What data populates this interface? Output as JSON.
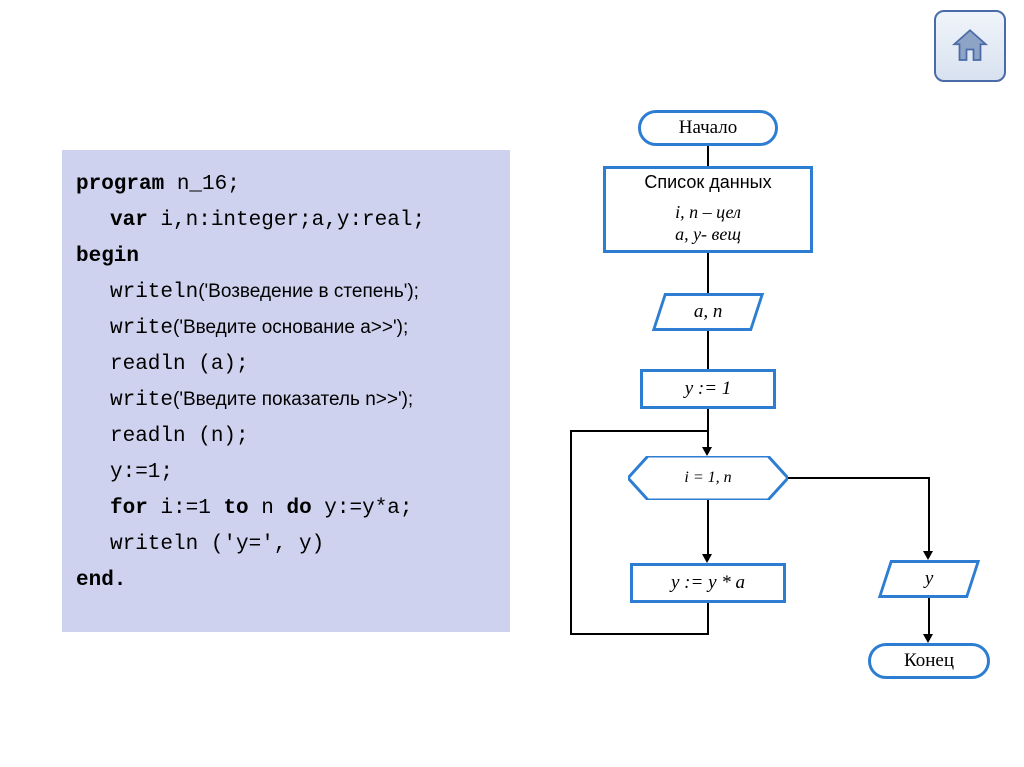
{
  "home": {
    "label": "home"
  },
  "code": {
    "line1_kw": "program",
    "line1_rest": " n_16;",
    "line2_kw": "var",
    "line2_rest": " i,n:integer;a,y:real;",
    "line3": "begin",
    "line4_fn": "writeln",
    "line4_txt": "('Возведение в степень');",
    "line5_fn": "write",
    "line5_txt": "('Введите основание a>>');",
    "line6": "readln (a);",
    "line7_fn": "write",
    "line7_txt": "('Введите показатель n>>');",
    "line8": "readln (n);",
    "line9": "y:=1;",
    "line10_for": "for",
    "line10_mid": " i:=1 ",
    "line10_to": "to",
    "line10_mid2": " n ",
    "line10_do": "do",
    "line10_rest": " y:=y*a;",
    "line11": "writeln ('y=', y)",
    "line12": "end."
  },
  "flow": {
    "start": "Начало",
    "datalist_title": "Список данных",
    "datalist_l1": "i, n – цел",
    "datalist_l2": "a, y- вещ",
    "input": "a, n",
    "init": "y := 1",
    "loop": "i = 1, n",
    "body": "y := y * a",
    "output": "y",
    "end": "Конец"
  }
}
